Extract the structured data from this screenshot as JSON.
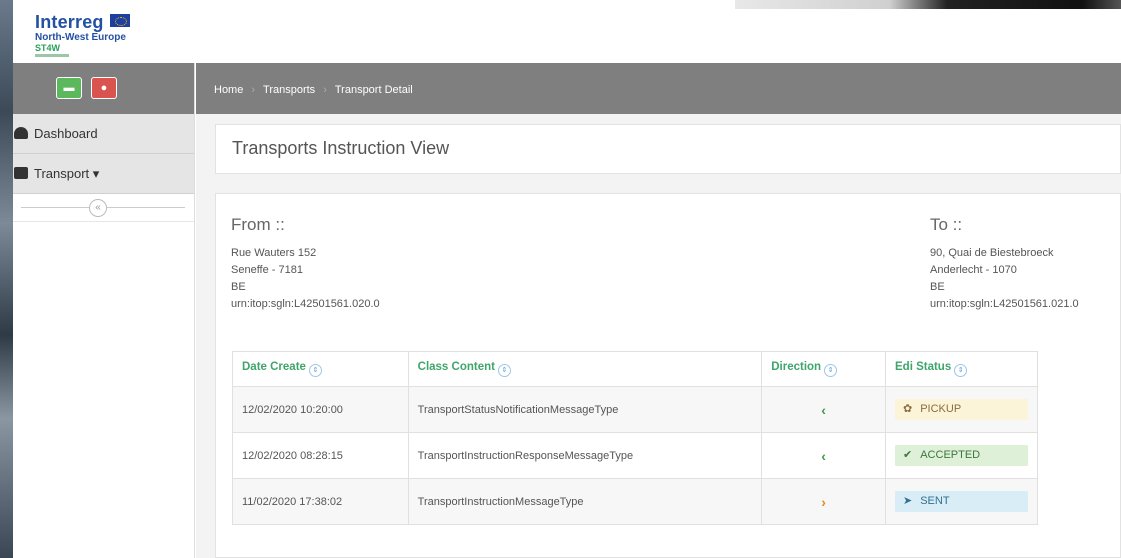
{
  "logo": {
    "title": "Interreg",
    "region": "North-West Europe",
    "project": "ST4W"
  },
  "breadcrumb": [
    "Home",
    "Transports",
    "Transport Detail"
  ],
  "sidebar": {
    "items": [
      {
        "label": "Dashboard",
        "icon": "dashboard-icon"
      },
      {
        "label": "Transport ▾",
        "icon": "truck-icon"
      }
    ],
    "collapse_symbol": "«"
  },
  "page": {
    "title": "Transports Instruction View"
  },
  "from": {
    "heading": "From ::",
    "street": "Rue Wauters 152",
    "city": "Seneffe - 7181",
    "country": "BE",
    "urn": "urn:itop:sgln:L42501561.020.0"
  },
  "to": {
    "heading": "To ::",
    "street": "90, Quai de Biestebroeck",
    "city": "Anderlecht - 1070",
    "country": "BE",
    "urn": "urn:itop:sgln:L42501561.021.0"
  },
  "table": {
    "headers": [
      "Date Create",
      "Class Content",
      "Direction",
      "Edi Status"
    ],
    "rows": [
      {
        "date": "12/02/2020 10:20:00",
        "content": "TransportStatusNotificationMessageType",
        "direction": "‹",
        "status": "PICKUP",
        "status_icon": "✿"
      },
      {
        "date": "12/02/2020 08:28:15",
        "content": "TransportInstructionResponseMessageType",
        "direction": "‹",
        "status": "ACCEPTED",
        "status_icon": "✔"
      },
      {
        "date": "11/02/2020 17:38:02",
        "content": "TransportInstructionMessageType",
        "direction": "›",
        "status": "SENT",
        "status_icon": "➤"
      }
    ]
  },
  "colors": {
    "accent_green": "#3fa56b",
    "bar_gray": "#7f7f7f",
    "btn_green": "#5cb85c",
    "btn_red": "#d9534f"
  }
}
